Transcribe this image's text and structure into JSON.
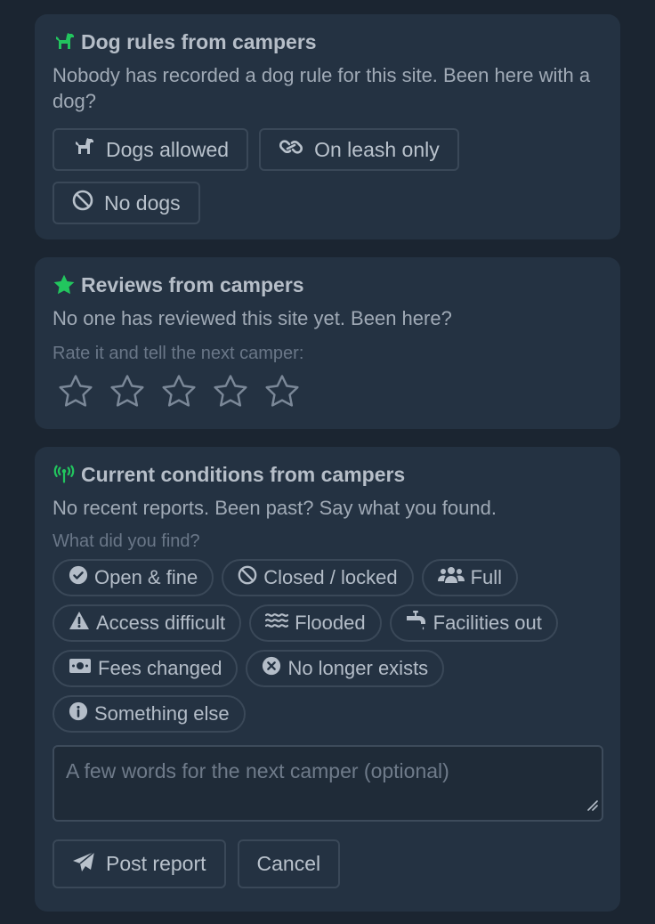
{
  "dogs": {
    "title": "Dog rules from campers",
    "description": "Nobody has recorded a dog rule for this site. Been here with a dog?",
    "options": [
      {
        "label": "Dogs allowed",
        "icon": "dog-icon"
      },
      {
        "label": "On leash only",
        "icon": "link-icon"
      },
      {
        "label": "No dogs",
        "icon": "ban-icon"
      }
    ]
  },
  "reviews": {
    "title": "Reviews from campers",
    "description": "No one has reviewed this site yet. Been here?",
    "rate_hint": "Rate it and tell the next camper:",
    "rating": 0,
    "max_rating": 5
  },
  "conditions": {
    "title": "Current conditions from campers",
    "description": "No recent reports. Been past? Say what you found.",
    "question": "What did you find?",
    "chips": [
      {
        "label": "Open & fine",
        "icon": "check-circle-icon"
      },
      {
        "label": "Closed / locked",
        "icon": "ban-icon"
      },
      {
        "label": "Full",
        "icon": "users-icon"
      },
      {
        "label": "Access difficult",
        "icon": "warning-icon"
      },
      {
        "label": "Flooded",
        "icon": "water-icon"
      },
      {
        "label": "Facilities out",
        "icon": "faucet-icon"
      },
      {
        "label": "Fees changed",
        "icon": "money-icon"
      },
      {
        "label": "No longer exists",
        "icon": "x-circle-icon"
      },
      {
        "label": "Something else",
        "icon": "info-icon"
      }
    ],
    "note_placeholder": "A few words for the next camper (optional)",
    "post_label": "Post report",
    "cancel_label": "Cancel"
  },
  "colors": {
    "accent": "#22c55e",
    "card_bg": "#243242",
    "page_bg": "#1b2531"
  }
}
